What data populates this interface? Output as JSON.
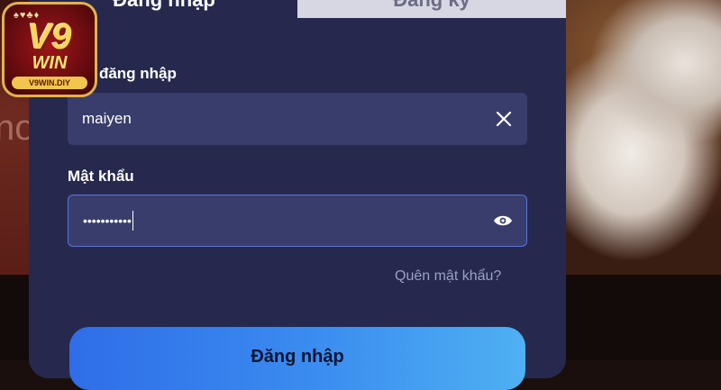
{
  "logo": {
    "brand": "V9",
    "win": "WIN",
    "domain": "V9WIN.DIY"
  },
  "tabs": {
    "login_label": "Đăng nhập",
    "register_label": "Đăng ký"
  },
  "form": {
    "username_label": "Tên đăng nhập",
    "username_value": "maiyen",
    "password_label": "Mật khẩu",
    "password_value": "•••••••••••",
    "forgot_link": "Quên mật khẩu?",
    "submit_label": "Đăng nhập"
  },
  "icons": {
    "clear": "close-icon",
    "show_password": "eye-icon"
  },
  "colors": {
    "modal_bg": "#26294d",
    "field_bg": "#393d6b",
    "focus_border": "#5875e0",
    "button_gradient_start": "#2f6de8",
    "button_gradient_end": "#4fb0f2"
  }
}
